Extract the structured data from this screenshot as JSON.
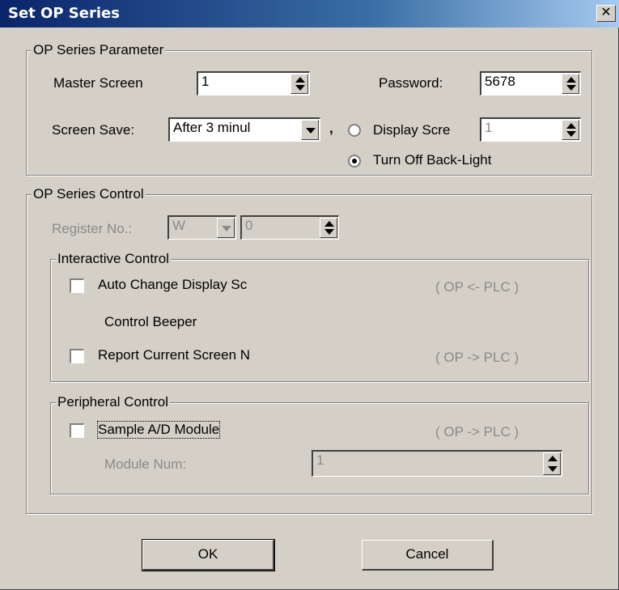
{
  "title": "Set OP Series",
  "close_glyph": "✕",
  "param_group": {
    "legend": "OP Series Parameter",
    "master_screen_label": "Master Screen",
    "master_screen_value": "1",
    "password_label": "Password:",
    "password_value": "5678",
    "screen_save_label": "Screen Save:",
    "screen_save_value": "After 3 minul",
    "comma": ",",
    "display_screen_label": "Display Scre",
    "display_screen_value": "1",
    "backlight_label": "Turn Off Back-Light"
  },
  "control_group": {
    "legend": "OP Series Control",
    "register_label": "Register No.:",
    "register_type": "W",
    "register_value": "0",
    "interactive": {
      "legend": "Interactive Control",
      "auto_change_label": "Auto Change Display Sc",
      "auto_change_dir": "( OP <- PLC )",
      "beeper_label": "Control Beeper",
      "report_label": "Report Current Screen N",
      "report_dir": "( OP -> PLC )"
    },
    "peripheral": {
      "legend": "Peripheral Control",
      "sample_label": "Sample A/D Module",
      "sample_dir": "( OP -> PLC )",
      "module_num_label": "Module Num:",
      "module_num_value": "1"
    }
  },
  "buttons": {
    "ok": "OK",
    "cancel": "Cancel"
  }
}
